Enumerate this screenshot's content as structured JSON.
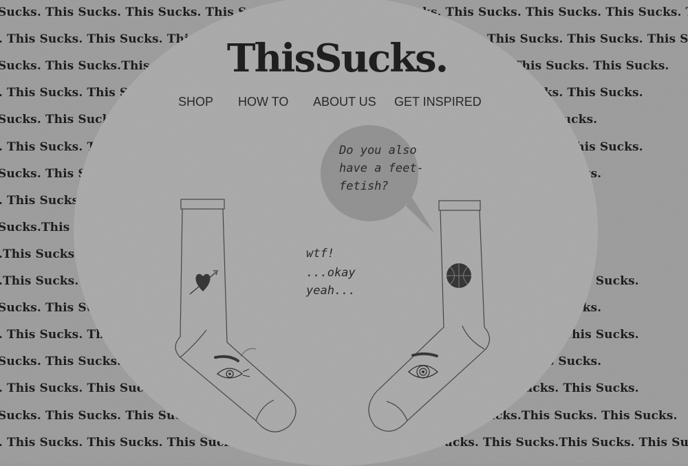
{
  "background_text": [
    "Sucks. This Sucks. This Sucks. This Sucks. This Sucks. This Sucks. This Sucks. This Sucks. This Sucks. This Sucks.",
    ". This Sucks. This Sucks. This Sucks. This Sucks. This Sucks. This Sucks. This Sucks. This Sucks. This Sucks.",
    "Sucks. This Sucks.This Sucks. This Sucks. This Sucks.This Sucks. This Sucks.This Sucks. This Sucks.",
    ". This Sucks. This Sucks. This Sucks. This Sucks. This Sucks. This Sucks. This Sucks. This Sucks.",
    "Sucks. This Sucks. This Sucks. This Sucks. This Sucks.This Sucks. This Sucks. This Sucks.",
    ". This Sucks. This Sucks. This Sucks. This Sucks. This Sucks. This Sucks. This Sucks. This Sucks.",
    "Sucks. This Sucks. This Sucks. This Sucks. This Sucks. This Sucks. This Sucks. This Sucks.",
    ". This Sucks. This Sucks. This Sucks. This Sucks. This Sucks. This Sucks. This Sucks.",
    "Sucks.This Sucks. This Sucks. This Sucks. This Sucks. This Sucks.This Sucks. This Sucks.",
    ".This Sucks. This Sucks. This Sucks. This Sucks. This Sucks. This Sucks. This Sucks.",
    ".This Sucks. This Sucks. This Sucks. This Sucks. This Sucks. This Sucks. This Sucks. This Sucks.",
    "Sucks. This Sucks. This Sucks. This Sucks. This Sucks. This Sucks. This Sucks. This Sucks.",
    ". This Sucks. This Sucks. This Sucks. This Sucks. This Sucks. This Sucks. This Sucks.This Sucks.",
    "Sucks. This Sucks. This Sucks. This Sucks. This Sucks. This Sucks. This Sucks. This Sucks.",
    ". This Sucks. This Sucks. This Sucks. This Sucks. This Sucks. This Sucks.This Sucks. This Sucks.",
    "Sucks. This Sucks. This Sucks. This Sucks. This Sucks. This Sucks. This Sucks.This Sucks. This Sucks.",
    ". This Sucks. This Sucks. This Sucks.This Sucks. This Sucks. This Sucks. This Sucks.This Sucks. This Sucks."
  ],
  "logo": {
    "text": "ThisSucks."
  },
  "nav": {
    "shop": "SHOP",
    "how_to": "HOW TO",
    "about_us": "ABOUT US",
    "get_inspired": "GET INSPIRED"
  },
  "illustration": {
    "speech_bubble_lines": [
      "Do you also",
      "have a feet-",
      "fetish?"
    ],
    "reply_lines": [
      "wtf!",
      "...okay",
      "yeah..."
    ],
    "left_sock_icons": [
      "heart-arrow-icon",
      "eye-icon"
    ],
    "right_sock_icons": [
      "basketball-icon",
      "eye-icon"
    ]
  },
  "colors": {
    "background": "#9a9a9a",
    "oval": "#a8a8a8",
    "bubble": "#8e8e8e",
    "ink": "#111111"
  }
}
